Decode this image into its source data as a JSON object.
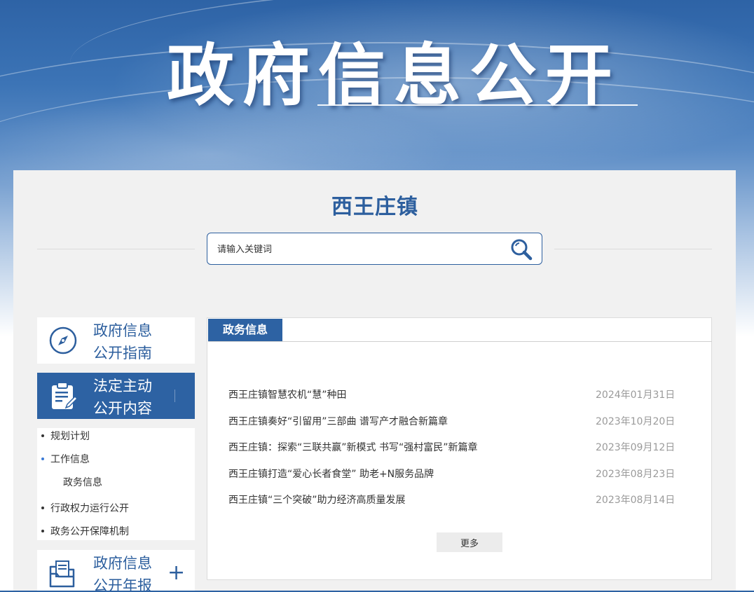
{
  "banner": {
    "title": "政府信息公开"
  },
  "town": {
    "name": "西王庄镇"
  },
  "search": {
    "placeholder": "请输入关键词"
  },
  "sidebar": {
    "guide": {
      "label_line1": "政府信息",
      "label_line2": "公开指南"
    },
    "statutory": {
      "label_line1": "法定主动",
      "label_line2": "公开内容"
    },
    "submenu": {
      "items": [
        {
          "label": "规划计划"
        },
        {
          "label": "工作信息",
          "children": [
            {
              "label": "政务信息"
            }
          ]
        },
        {
          "label": "行政权力运行公开"
        },
        {
          "label": "政务公开保障机制"
        }
      ]
    },
    "annual": {
      "label_line1": "政府信息",
      "label_line2": "公开年报",
      "toggle": "+"
    }
  },
  "content": {
    "tab_label": "政务信息",
    "news": [
      {
        "title": "西王庄镇智慧农机“慧”种田",
        "date": "2024年01月31日"
      },
      {
        "title": "西王庄镇奏好“引留用”三部曲 谱写产才融合新篇章",
        "date": "2023年10月20日"
      },
      {
        "title": "西王庄镇：探索“三联共赢”新模式 书写“强村富民”新篇章",
        "date": "2023年09月12日"
      },
      {
        "title": "西王庄镇打造“爱心长者食堂” 助老+N服务品牌",
        "date": "2023年08月23日"
      },
      {
        "title": "西王庄镇“三个突破”助力经济高质量发展",
        "date": "2023年08月14日"
      }
    ],
    "more_label": "更多"
  },
  "colors": {
    "brand": "#2d62a3",
    "title_blue": "#2d5f9e",
    "date_gray": "#9a9a9a"
  },
  "icons": {
    "search": "magnifier-icon",
    "guide": "compass-icon",
    "statutory": "clipboard-edit-icon",
    "annual": "folder-document-icon"
  }
}
